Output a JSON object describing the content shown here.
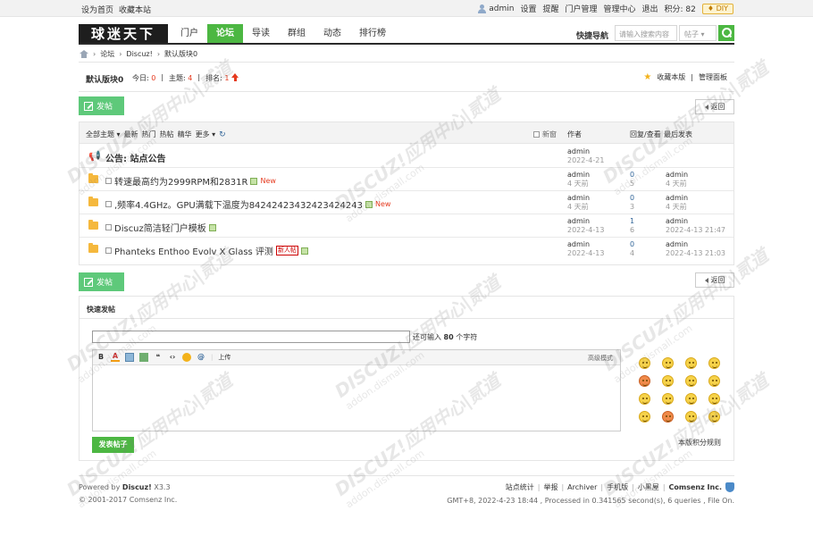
{
  "topbar": {
    "left_links": [
      "设为首页",
      "收藏本站"
    ],
    "username": "admin",
    "right_links": [
      "设置",
      "提醒",
      "门户管理",
      "管理中心",
      "退出"
    ],
    "credits": "积分: 82",
    "diy": "DIY"
  },
  "header": {
    "logo": "球迷天下",
    "nav": [
      {
        "label": "门户",
        "active": false
      },
      {
        "label": "论坛",
        "active": true
      },
      {
        "label": "导读",
        "active": false
      },
      {
        "label": "群组",
        "active": false
      },
      {
        "label": "动态",
        "active": false
      },
      {
        "label": "排行榜",
        "active": false
      }
    ],
    "quick_nav": "快捷导航",
    "search_placeholder": "请输入搜索内容",
    "search_type": "帖子 ▾"
  },
  "breadcrumb": [
    "论坛",
    "Discuz!",
    "默认版块0"
  ],
  "forum": {
    "name": "默认版块0",
    "today_label": "今日:",
    "today_value": "0",
    "topics_label": "主题:",
    "topics_value": "4",
    "rank_label": "排名:",
    "rank_value": "1",
    "favorite": "收藏本版",
    "manage": "管理面板"
  },
  "buttons": {
    "post": "发帖",
    "back": "返回"
  },
  "thread_list": {
    "filters": [
      "全部主题 ▾",
      "最新",
      "热门",
      "热帖",
      "精华",
      "更多 ▾"
    ],
    "new_window": "新窗",
    "col_author": "作者",
    "col_replies": "回复/查看",
    "col_last": "最后发表",
    "announcement": {
      "title": "公告: 站点公告",
      "author": "admin",
      "date": "2022-4-21"
    },
    "rows": [
      {
        "title": "转速最高约为2999RPM和2831R",
        "tags": [
          "attach",
          "new"
        ],
        "author": "admin",
        "date": "4 天前",
        "replies": "0",
        "views": "5",
        "last_user": "admin",
        "last_time": "4 天前"
      },
      {
        "title": ",频率4.4GHz。GPU满载下温度为84242423432423424243",
        "tags": [
          "attach",
          "new"
        ],
        "author": "admin",
        "date": "4 天前",
        "replies": "0",
        "views": "3",
        "last_user": "admin",
        "last_time": "4 天前"
      },
      {
        "title": "Discuz简洁轻门户模板",
        "tags": [
          "attach"
        ],
        "author": "admin",
        "date": "2022-4-13",
        "replies": "1",
        "views": "6",
        "last_user": "admin",
        "last_time": "2022-4-13 21:47"
      },
      {
        "title": "Phanteks Enthoo Evolv X Glass 评测",
        "tags": [
          "newbie",
          "attach"
        ],
        "author": "admin",
        "date": "2022-4-13",
        "replies": "0",
        "views": "4",
        "last_user": "admin",
        "last_time": "2022-4-13 21:03"
      }
    ],
    "new_tag": "New",
    "newbie_tag": "新人帖"
  },
  "quick_post": {
    "title": "快速发帖",
    "hint_prefix": "还可输入",
    "hint_count": "80",
    "hint_suffix": "个字符",
    "toolbar": [
      "B",
      "A",
      "上传"
    ],
    "advanced": "高级模式",
    "submit": "发表帖子",
    "rules": "本版积分规则"
  },
  "footer": {
    "powered_prefix": "Powered by",
    "powered_brand": "Discuz!",
    "powered_version": "X3.3",
    "copyright": "© 2001-2017 Comsenz Inc.",
    "links": [
      "站点统计",
      "举报",
      "Archiver",
      "手机版",
      "小黑屋",
      "Comsenz Inc."
    ],
    "timing": "GMT+8, 2022-4-23 18:44 , Processed in 0.341565 second(s), 6 queries , File On."
  },
  "watermark": {
    "line1": "DISCUZ!应用中心|贰道",
    "line2": "addon.dismall.com"
  }
}
